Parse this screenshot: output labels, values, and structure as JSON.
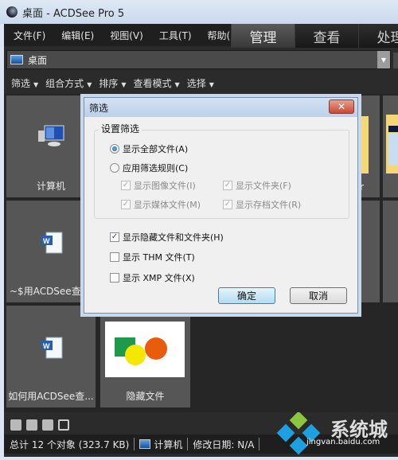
{
  "window": {
    "title": "桌面 - ACDSee Pro 5"
  },
  "menu": [
    "文件(F)",
    "编辑(E)",
    "视图(V)",
    "工具(T)",
    "帮助(H)"
  ],
  "modes": [
    {
      "label": "管理",
      "active": true
    },
    {
      "label": "查看",
      "active": false
    },
    {
      "label": "处理",
      "active": false
    }
  ],
  "path": {
    "value": "桌面"
  },
  "toolbar": [
    "筛选",
    "组合方式",
    "排序",
    "查看模式",
    "选择"
  ],
  "tiles": [
    {
      "label": "计算机",
      "icon": "computer-icon"
    },
    {
      "label": "~$用ACDSee查看",
      "icon": "word-doc-icon"
    },
    {
      "label": "如何用ACDSee查...",
      "icon": "word-doc-icon"
    },
    {
      "label": "隐藏文件",
      "icon": "image-thumbnail"
    },
    {
      "label": "r",
      "icon": "folder-icon"
    }
  ],
  "status": {
    "total": "总计 12 个对象 (323.7 KB)",
    "location": "计算机",
    "modified": "修改日期: N/A"
  },
  "dialog": {
    "title": "筛选",
    "group_label": "设置筛选",
    "radio_all": "显示全部文件(A)",
    "radio_rules": "应用筛选规则(C)",
    "sub": {
      "images": "显示图像文件(I)",
      "folders": "显示文件夹(F)",
      "media": "显示媒体文件(M)",
      "archives": "显示存档文件(R)"
    },
    "hidden": "显示隐藏文件和文件夹(H)",
    "thm": "显示 THM 文件(T)",
    "xmp": "显示 XMP 文件(X)",
    "ok": "确定",
    "cancel": "取消",
    "close": "✕"
  },
  "watermark": {
    "brand": "系统城",
    "url": "jingvan.baidu.com"
  }
}
